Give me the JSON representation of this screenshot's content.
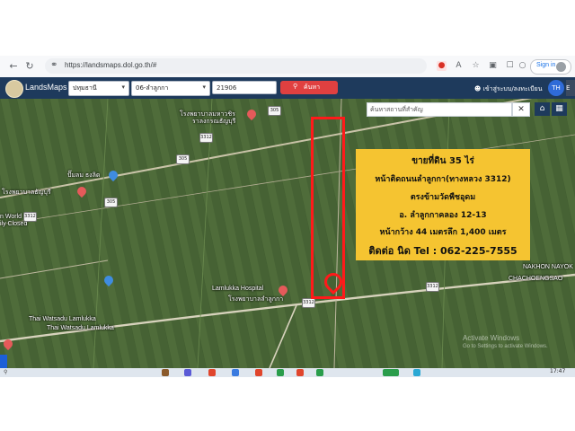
{
  "browser": {
    "url": "https://landsmaps.dol.go.th/#",
    "sign_in": "Sign in",
    "back_icon": "arrow-left-icon",
    "forward_icon": "arrow-right-icon",
    "reload_icon": "reload-icon"
  },
  "app": {
    "title": "LandsMaps",
    "province": "ปทุมธานี",
    "district": "06-ลำลูกกา",
    "parcel_no": "21906",
    "search_label": "ค้นหา",
    "login_label": "เข้าสู่ระบบ/ลงทะเบียน",
    "avatar_label": "TH",
    "avatar2_label": "E"
  },
  "map": {
    "search_placeholder": "ค้นหาสถานที่สำคัญ",
    "clear_label": "✕",
    "home_icon": "home-icon",
    "grid_icon": "grid-icon",
    "pois": [
      {
        "label": "โรงพยาบาลมหาวชิร",
        "icon": "hospital-icon"
      },
      {
        "label": "ราลงกรณธัญบุรี",
        "icon": ""
      },
      {
        "label": "ปั๊มลม ธงลิด",
        "icon": "fuel-icon"
      },
      {
        "label": "โรงพยาบาลธัญบุรี",
        "icon": "hospital-icon"
      },
      {
        "label": "n World",
        "icon": ""
      },
      {
        "label": "ily Closed",
        "icon": ""
      },
      {
        "label": "Lamlukka Hospital",
        "icon": "hospital-icon"
      },
      {
        "label": "โรงพยาบาลลำลูกกา",
        "icon": ""
      },
      {
        "label": "Thai Watsadu Lamlukka",
        "icon": "store-icon"
      },
      {
        "label": "Thai Watsadu Lamlukka",
        "icon": ""
      },
      {
        "label": "NAKHON NAYOK",
        "icon": ""
      },
      {
        "label": "CHACHOENGSAO",
        "icon": ""
      }
    ],
    "road_numbers": [
      "305",
      "3312",
      "3312",
      "305",
      "305",
      "3312",
      "3312"
    ],
    "road_numbers_alt": [
      "3312",
      "3312",
      "305",
      "305"
    ],
    "watermark_line1": "Activate Windows",
    "watermark_line2": "Go to Settings to activate Windows."
  },
  "banner": {
    "line1": "ขายที่ดิน 35 ไร่",
    "line2": "หน้าติดถนนลำลูกกา(ทางหลวง 3312)",
    "line3": "ตรงข้ามวัดพืชอุดม",
    "line4": "อ. ลำลูกกาคลอง 12-13",
    "line5": "หน้ากว้าง 44 เมตรลึก 1,400 เมตร",
    "line6": "ติดต่อ นิด Tel : 062-225-7555"
  },
  "taskbar": {
    "search_text": "",
    "clock": "17:47"
  },
  "colors": {
    "header": "#1e3a5c",
    "search_button": "#e04040",
    "banner": "#f5c431",
    "plot_outline": "#ff1a1a"
  }
}
